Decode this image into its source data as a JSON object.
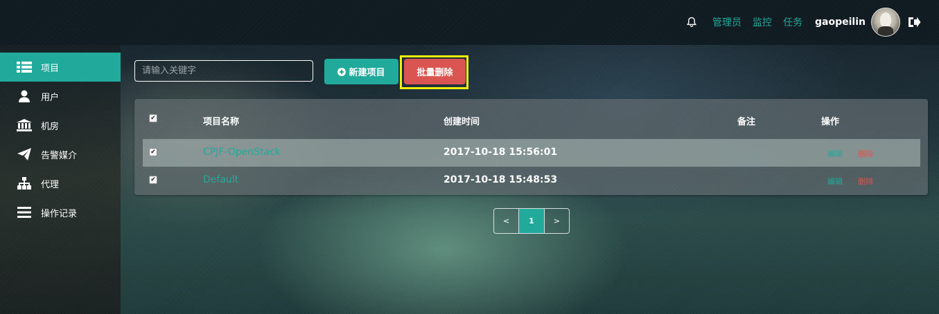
{
  "header": {
    "nav_links": [
      "管理员",
      "监控",
      "任务"
    ],
    "username": "gaopeilin",
    "accent": "#1fa99a"
  },
  "sidebar": {
    "items": [
      {
        "label": "项目",
        "icon": "list-icon",
        "active": true
      },
      {
        "label": "用户",
        "icon": "user-icon",
        "active": false
      },
      {
        "label": "机房",
        "icon": "building-icon",
        "active": false
      },
      {
        "label": "告警媒介",
        "icon": "paper-plane-icon",
        "active": false
      },
      {
        "label": "代理",
        "icon": "sitemap-icon",
        "active": false
      },
      {
        "label": "操作记录",
        "icon": "menu-icon",
        "active": false
      }
    ]
  },
  "toolbar": {
    "search_placeholder": "请输入关键字",
    "search_value": "",
    "new_label": "新建项目",
    "delete_label": "批量删除",
    "delete_color": "#d9534f"
  },
  "table": {
    "columns": [
      "项目名称",
      "创建时间",
      "备注",
      "操作"
    ],
    "rows": [
      {
        "name": "CPJF-OpenStack",
        "created": "2017-10-18 15:56:01",
        "note": "",
        "edit": "编辑",
        "delete": "删除",
        "checked": true
      },
      {
        "name": "Default",
        "created": "2017-10-18 15:48:53",
        "note": "",
        "edit": "编辑",
        "delete": "删除",
        "checked": true
      }
    ]
  },
  "pagination": {
    "prev": "<",
    "current": "1",
    "next": ">"
  }
}
